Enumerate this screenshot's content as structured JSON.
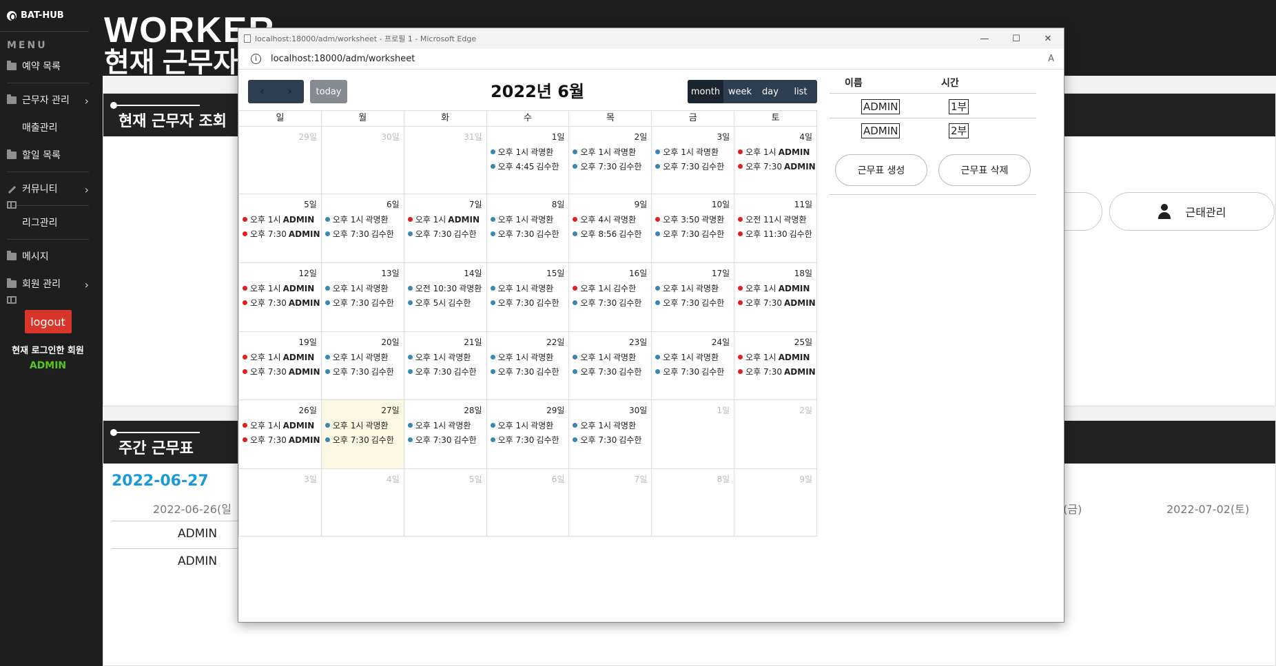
{
  "sidebar": {
    "brand": "BAT-HUB",
    "menu_title": "MENU",
    "items": [
      {
        "label": "예약 목록",
        "icon": "folder-icon"
      },
      {
        "label": "근무자 관리",
        "icon": "folder-icon",
        "has_submenu": true
      },
      {
        "label": "매출관리",
        "icon": "grid-icon"
      },
      {
        "label": "할일 목록",
        "icon": "folder-icon"
      },
      {
        "label": "커뮤니티",
        "icon": "wrench-icon",
        "has_submenu": true
      },
      {
        "label": "리그관리",
        "icon": "grid-icon"
      },
      {
        "label": "메시지",
        "icon": "folder-icon"
      },
      {
        "label": "회원 관리",
        "icon": "folder-icon",
        "has_submenu": true
      }
    ],
    "logout": "logout",
    "login_label": "현재 로그인한 회원",
    "login_user": "ADMIN"
  },
  "background": {
    "header_title": "WORKER",
    "header_sub": "현재 근무자",
    "panel1_title": "현재 근무자 조회",
    "panel2_title": "주간 근무표",
    "pill_button": "근태관리",
    "week_date": "2022-06-27",
    "week_col_left": "2022-06-26(일",
    "week_col_right_partial": "1(금)",
    "week_col_last": "2022-07-02(토)",
    "week_rows": [
      "ADMIN",
      "ADMIN"
    ]
  },
  "browser": {
    "window_title": "localhost:18000/adm/worksheet - 프로필 1 - Microsoft Edge",
    "url_host": "localhost:",
    "url_rest": "18000/adm/worksheet",
    "controls": {
      "minimize": "—",
      "maximize": "☐",
      "close": "✕"
    }
  },
  "calendar": {
    "title": "2022년 6월",
    "today": "today",
    "prev": "‹",
    "next": "›",
    "views": [
      "month",
      "week",
      "day",
      "list"
    ],
    "active_view": "month",
    "dow": [
      "일",
      "월",
      "화",
      "수",
      "목",
      "금",
      "토"
    ],
    "colors": {
      "blue": "#3a87ad",
      "red": "#e02020",
      "today_bg": "#fcf8e3"
    },
    "weeks": [
      [
        {
          "d": "29일",
          "other": true,
          "ev": []
        },
        {
          "d": "30일",
          "other": true,
          "ev": []
        },
        {
          "d": "31일",
          "other": true,
          "ev": []
        },
        {
          "d": "1일",
          "ev": [
            {
              "c": "blue",
              "t": "오후 1시",
              "n": "곽명환"
            },
            {
              "c": "blue",
              "t": "오후 4:45",
              "n": "김수한"
            }
          ]
        },
        {
          "d": "2일",
          "ev": [
            {
              "c": "blue",
              "t": "오후 1시",
              "n": "곽명환"
            },
            {
              "c": "blue",
              "t": "오후 7:30",
              "n": "김수한"
            }
          ]
        },
        {
          "d": "3일",
          "ev": [
            {
              "c": "blue",
              "t": "오후 1시",
              "n": "곽명환"
            },
            {
              "c": "blue",
              "t": "오후 7:30",
              "n": "김수한"
            }
          ]
        },
        {
          "d": "4일",
          "ev": [
            {
              "c": "red",
              "t": "오후 1시",
              "n": "ADMIN",
              "b": true
            },
            {
              "c": "red",
              "t": "오후 7:30",
              "n": "ADMIN",
              "b": true
            }
          ]
        }
      ],
      [
        {
          "d": "5일",
          "ev": [
            {
              "c": "red",
              "t": "오후 1시",
              "n": "ADMIN",
              "b": true
            },
            {
              "c": "red",
              "t": "오후 7:30",
              "n": "ADMIN",
              "b": true
            }
          ]
        },
        {
          "d": "6일",
          "ev": [
            {
              "c": "blue",
              "t": "오후 1시",
              "n": "곽명환"
            },
            {
              "c": "blue",
              "t": "오후 7:30",
              "n": "김수한"
            }
          ]
        },
        {
          "d": "7일",
          "ev": [
            {
              "c": "red",
              "t": "오후 1시",
              "n": "ADMIN",
              "b": true
            },
            {
              "c": "blue",
              "t": "오후 7:30",
              "n": "김수한"
            }
          ]
        },
        {
          "d": "8일",
          "ev": [
            {
              "c": "blue",
              "t": "오후 1시",
              "n": "곽명환"
            },
            {
              "c": "blue",
              "t": "오후 7:30",
              "n": "김수한"
            }
          ]
        },
        {
          "d": "9일",
          "ev": [
            {
              "c": "red",
              "t": "오후 4시",
              "n": "곽명환"
            },
            {
              "c": "blue",
              "t": "오후 8:56",
              "n": "김수한"
            }
          ]
        },
        {
          "d": "10일",
          "ev": [
            {
              "c": "red",
              "t": "오후 3:50",
              "n": "곽명환"
            },
            {
              "c": "blue",
              "t": "오후 7:30",
              "n": "김수한"
            }
          ]
        },
        {
          "d": "11일",
          "ev": [
            {
              "c": "red",
              "t": "오전 11시",
              "n": "곽명환"
            },
            {
              "c": "red",
              "t": "오후 11:30",
              "n": "김수한"
            }
          ]
        }
      ],
      [
        {
          "d": "12일",
          "ev": [
            {
              "c": "red",
              "t": "오후 1시",
              "n": "ADMIN",
              "b": true
            },
            {
              "c": "red",
              "t": "오후 7:30",
              "n": "ADMIN",
              "b": true
            }
          ]
        },
        {
          "d": "13일",
          "ev": [
            {
              "c": "blue",
              "t": "오후 1시",
              "n": "곽명환"
            },
            {
              "c": "blue",
              "t": "오후 7:30",
              "n": "김수한"
            }
          ]
        },
        {
          "d": "14일",
          "ev": [
            {
              "c": "blue",
              "t": "오전 10:30",
              "n": "곽명환"
            },
            {
              "c": "blue",
              "t": "오후 5시",
              "n": "김수한"
            }
          ]
        },
        {
          "d": "15일",
          "ev": [
            {
              "c": "blue",
              "t": "오후 1시",
              "n": "곽명환"
            },
            {
              "c": "blue",
              "t": "오후 7:30",
              "n": "김수한"
            }
          ]
        },
        {
          "d": "16일",
          "ev": [
            {
              "c": "red",
              "t": "오후 1시",
              "n": "김수한"
            },
            {
              "c": "blue",
              "t": "오후 7:30",
              "n": "김수한"
            }
          ]
        },
        {
          "d": "17일",
          "ev": [
            {
              "c": "blue",
              "t": "오후 1시",
              "n": "곽명환"
            },
            {
              "c": "blue",
              "t": "오후 7:30",
              "n": "김수한"
            }
          ]
        },
        {
          "d": "18일",
          "ev": [
            {
              "c": "red",
              "t": "오후 1시",
              "n": "ADMIN",
              "b": true
            },
            {
              "c": "red",
              "t": "오후 7:30",
              "n": "ADMIN",
              "b": true
            }
          ]
        }
      ],
      [
        {
          "d": "19일",
          "ev": [
            {
              "c": "red",
              "t": "오후 1시",
              "n": "ADMIN",
              "b": true
            },
            {
              "c": "red",
              "t": "오후 7:30",
              "n": "ADMIN",
              "b": true
            }
          ]
        },
        {
          "d": "20일",
          "ev": [
            {
              "c": "blue",
              "t": "오후 1시",
              "n": "곽명환"
            },
            {
              "c": "blue",
              "t": "오후 7:30",
              "n": "김수한"
            }
          ]
        },
        {
          "d": "21일",
          "ev": [
            {
              "c": "blue",
              "t": "오후 1시",
              "n": "곽명환"
            },
            {
              "c": "blue",
              "t": "오후 7:30",
              "n": "김수한"
            }
          ]
        },
        {
          "d": "22일",
          "ev": [
            {
              "c": "blue",
              "t": "오후 1시",
              "n": "곽명환"
            },
            {
              "c": "blue",
              "t": "오후 7:30",
              "n": "김수한"
            }
          ]
        },
        {
          "d": "23일",
          "ev": [
            {
              "c": "blue",
              "t": "오후 1시",
              "n": "곽명환"
            },
            {
              "c": "blue",
              "t": "오후 7:30",
              "n": "김수한"
            }
          ]
        },
        {
          "d": "24일",
          "ev": [
            {
              "c": "blue",
              "t": "오후 1시",
              "n": "곽명환"
            },
            {
              "c": "blue",
              "t": "오후 7:30",
              "n": "김수한"
            }
          ]
        },
        {
          "d": "25일",
          "ev": [
            {
              "c": "red",
              "t": "오후 1시",
              "n": "ADMIN",
              "b": true
            },
            {
              "c": "red",
              "t": "오후 7:30",
              "n": "ADMIN",
              "b": true
            }
          ]
        }
      ],
      [
        {
          "d": "26일",
          "ev": [
            {
              "c": "red",
              "t": "오후 1시",
              "n": "ADMIN",
              "b": true
            },
            {
              "c": "red",
              "t": "오후 7:30",
              "n": "ADMIN",
              "b": true
            }
          ]
        },
        {
          "d": "27일",
          "today": true,
          "ev": [
            {
              "c": "blue",
              "t": "오후 1시",
              "n": "곽명환"
            },
            {
              "c": "blue",
              "t": "오후 7:30",
              "n": "김수한"
            }
          ]
        },
        {
          "d": "28일",
          "ev": [
            {
              "c": "blue",
              "t": "오후 1시",
              "n": "곽명환"
            },
            {
              "c": "blue",
              "t": "오후 7:30",
              "n": "김수한"
            }
          ]
        },
        {
          "d": "29일",
          "ev": [
            {
              "c": "blue",
              "t": "오후 1시",
              "n": "곽명환"
            },
            {
              "c": "blue",
              "t": "오후 7:30",
              "n": "김수한"
            }
          ]
        },
        {
          "d": "30일",
          "ev": [
            {
              "c": "blue",
              "t": "오후 1시",
              "n": "곽명환"
            },
            {
              "c": "blue",
              "t": "오후 7:30",
              "n": "김수한"
            }
          ]
        },
        {
          "d": "1일",
          "other": true,
          "ev": []
        },
        {
          "d": "2일",
          "other": true,
          "ev": []
        }
      ],
      [
        {
          "d": "3일",
          "other": true,
          "ev": []
        },
        {
          "d": "4일",
          "other": true,
          "ev": []
        },
        {
          "d": "5일",
          "other": true,
          "ev": []
        },
        {
          "d": "6일",
          "other": true,
          "ev": []
        },
        {
          "d": "7일",
          "other": true,
          "ev": []
        },
        {
          "d": "8일",
          "other": true,
          "ev": []
        },
        {
          "d": "9일",
          "other": true,
          "ev": []
        }
      ]
    ]
  },
  "side_panel": {
    "col_name": "이름",
    "col_time": "시간",
    "rows": [
      {
        "name": "ADMIN",
        "time": "1부"
      },
      {
        "name": "ADMIN",
        "time": "2부"
      }
    ],
    "create_button": "근무표 생성",
    "delete_button": "근무표 삭제"
  }
}
